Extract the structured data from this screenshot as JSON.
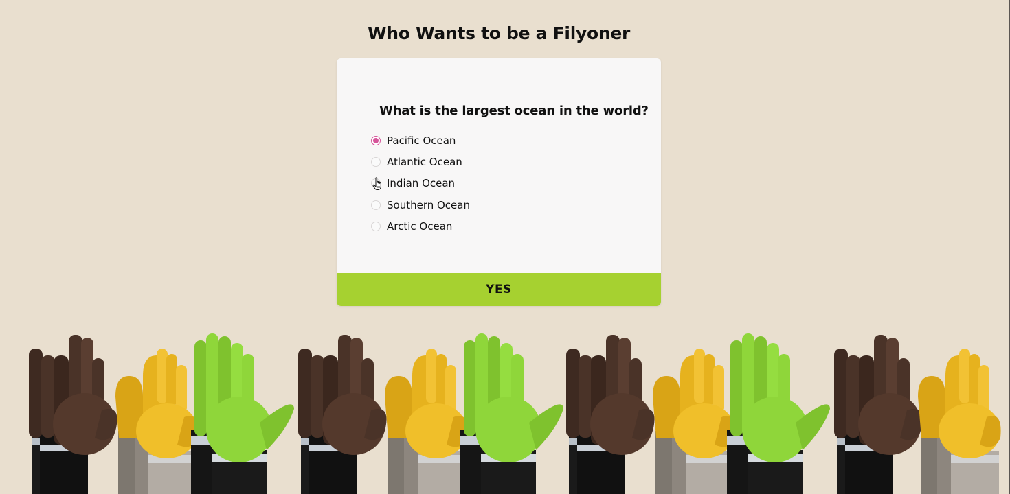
{
  "page": {
    "title": "Who Wants to be a Filyoner"
  },
  "quiz": {
    "question": "What is the largest ocean in the world?",
    "options": [
      {
        "label": "Pacific Ocean",
        "selected": true
      },
      {
        "label": "Atlantic Ocean",
        "selected": false
      },
      {
        "label": "Indian Ocean",
        "selected": false
      },
      {
        "label": "Southern Ocean",
        "selected": false
      },
      {
        "label": "Arctic Ocean",
        "selected": false
      }
    ],
    "submit_label": "YES"
  },
  "illustration": {
    "subject": "raised-hands-crowd",
    "hand_colors": [
      "#4a3328",
      "#e6b21e",
      "#8fd63a"
    ],
    "sleeve_colors": [
      "#1e1e1e",
      "#a9a39d",
      "#d0d0d0"
    ]
  },
  "colors": {
    "background": "#e9dfcf",
    "card": "#f8f7f7",
    "accent_radio": "#d6559a",
    "button": "#a6d130"
  }
}
